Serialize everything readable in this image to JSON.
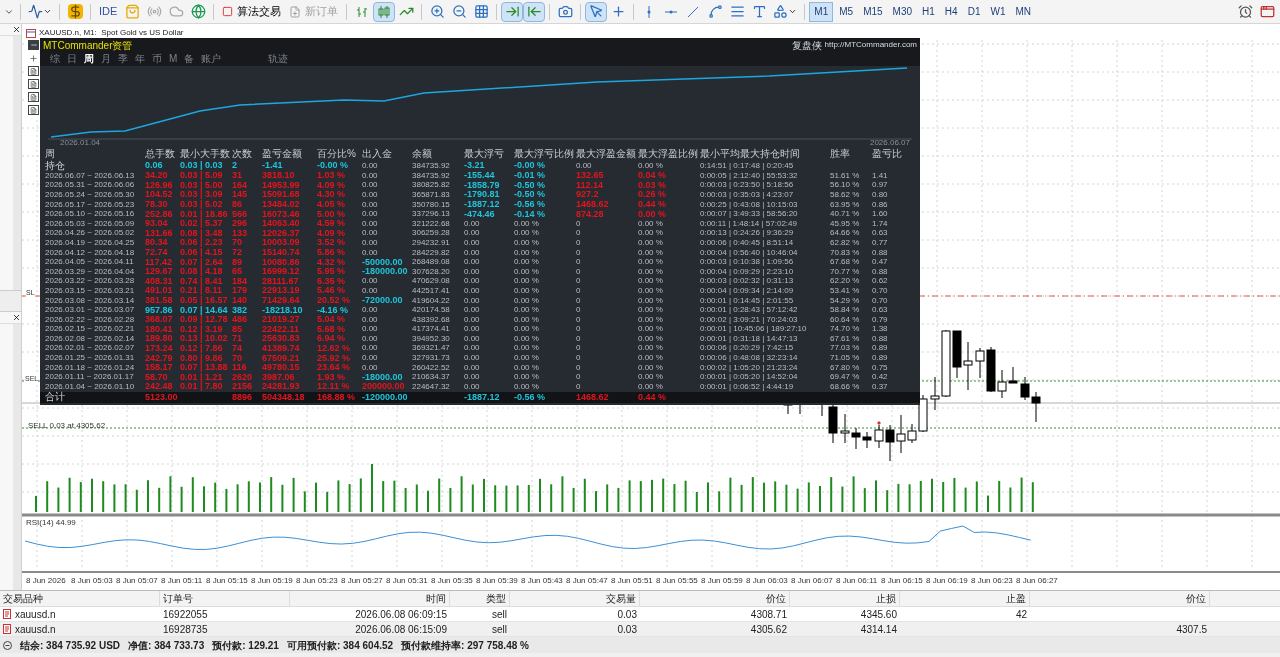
{
  "toolbar": {
    "ide": "IDE",
    "algo_trading": {
      "label": "算法交易",
      "on": false
    },
    "new_order": {
      "label": "新订单",
      "disabled": true
    },
    "chart_types": [
      {
        "selected": false
      },
      {
        "selected": true
      },
      {
        "selected": false
      }
    ],
    "scroll_buttons": [
      {
        "selected": true
      },
      {
        "selected": true
      }
    ],
    "cursor_buttons": [
      {
        "selected": true
      },
      {
        "selected": false
      }
    ],
    "timeframes": [
      {
        "label": "M1",
        "selected": true
      },
      {
        "label": "M5",
        "selected": false
      },
      {
        "label": "M15",
        "selected": false
      },
      {
        "label": "M30",
        "selected": false
      },
      {
        "label": "H1",
        "selected": false
      },
      {
        "label": "H4",
        "selected": false
      },
      {
        "label": "D1",
        "selected": false
      },
      {
        "label": "W1",
        "selected": false
      },
      {
        "label": "MN",
        "selected": false
      }
    ]
  },
  "chart": {
    "title": "XAUUSD.n, M1:  Spot Gold vs US Dollar",
    "sl_label": "SL",
    "sell_label": "SEL",
    "order_label": "SELL 0.03 at 4305.62",
    "rsi_label": "RSI(14) 44.99",
    "time_labels": [
      "8 Jun 2026",
      "8 Jun 05:03",
      "8 Jun 05:07",
      "8 Jun 05:11",
      "8 Jun 05:15",
      "8 Jun 05:19",
      "8 Jun 05:23",
      "8 Jun 05:27",
      "8 Jun 05:31",
      "8 Jun 05:35",
      "8 Jun 05:39",
      "8 Jun 05:43",
      "8 Jun 05:47",
      "8 Jun 05:51",
      "8 Jun 05:55",
      "8 Jun 05:59",
      "8 Jun 06:03",
      "8 Jun 06:07",
      "8 Jun 06:11",
      "8 Jun 06:15",
      "8 Jun 06:19",
      "8 Jun 06:23",
      "8 Jun 06:27"
    ]
  },
  "panel": {
    "title": "MTCommander资管",
    "brand": "复盘侠",
    "link": "http://MTCommander.com",
    "tabs": [
      {
        "label": "综",
        "selected": false
      },
      {
        "label": "日",
        "selected": false
      },
      {
        "label": "周",
        "selected": true
      },
      {
        "label": "月",
        "selected": false
      },
      {
        "label": "季",
        "selected": false
      },
      {
        "label": "年",
        "selected": false
      },
      {
        "label": "币",
        "selected": false
      },
      {
        "label": "M",
        "selected": false
      },
      {
        "label": "备",
        "selected": false
      },
      {
        "label": "账户",
        "selected": false
      },
      {
        "label": "轨迹",
        "selected": false
      }
    ],
    "equity": {
      "start_date": "2026.01.04",
      "end_date": "2026.06.07"
    },
    "table": {
      "columns": [
        "周",
        "总手数",
        "最小大手数",
        "次数",
        "盈亏金额",
        "百分比%",
        "出入金",
        "余额",
        "最大浮亏",
        "最大浮亏比例",
        "最大浮盈金额",
        "最大浮盈比例",
        "最小平均最大持仓时间",
        "胜率",
        "盈亏比"
      ],
      "rows": [
        {
          "kind": "position",
          "cells": [
            {
              "text": "持仓"
            },
            {
              "text": "0.06",
              "color": "#1cc6dc"
            },
            {
              "text": "0.03 | 0.03",
              "color": "#1cc6dc"
            },
            {
              "text": "2",
              "color": "#1cc6dc"
            },
            {
              "text": "-1.41",
              "color": "#1cc6dc"
            },
            {
              "text": "-0.00 %",
              "color": "#1cc6dc"
            },
            {
              "text": "0.00"
            },
            {
              "text": "384735.92"
            },
            {
              "text": "-3.21",
              "color": "#1cc6dc"
            },
            {
              "text": "-0.00 %",
              "color": "#1cc6dc"
            },
            {
              "text": "0.00"
            },
            {
              "text": "0.00 %"
            },
            {
              "text": "0:14:51 | 0:17:48 | 0:20:45"
            },
            null,
            null
          ]
        },
        {
          "kind": "week",
          "cells": [
            {
              "text": "2026.06.07 ~ 2026.06.13"
            },
            {
              "text": "34.20",
              "color": "#e3141e"
            },
            {
              "text": "0.03 | 5.09",
              "color": "#e3141e"
            },
            {
              "text": "31",
              "color": "#e3141e"
            },
            {
              "text": "3818.10",
              "color": "#e3141e"
            },
            {
              "text": "1.03 %",
              "color": "#e3141e"
            },
            {
              "text": "0.00"
            },
            {
              "text": "384735.92"
            },
            {
              "text": "-155.44",
              "color": "#1cc6dc"
            },
            {
              "text": "-0.01 %",
              "color": "#1cc6dc"
            },
            {
              "text": "132.65",
              "color": "#e3141e"
            },
            {
              "text": "0.04 %",
              "color": "#e3141e"
            },
            {
              "text": "0:00:05 | 2:12:40 | 55:53:32"
            },
            {
              "text": "51.61 %"
            },
            {
              "text": "1.41"
            }
          ]
        },
        {
          "kind": "week",
          "cells": [
            {
              "text": "2026.05.31 ~ 2026.06.06"
            },
            {
              "text": "126.96",
              "color": "#e3141e"
            },
            {
              "text": "0.03 | 5.00",
              "color": "#e3141e"
            },
            {
              "text": "164",
              "color": "#e3141e"
            },
            {
              "text": "14953.99",
              "color": "#e3141e"
            },
            {
              "text": "4.09 %",
              "color": "#e3141e"
            },
            {
              "text": "0.00"
            },
            {
              "text": "380825.82"
            },
            {
              "text": "-1858.79",
              "color": "#1cc6dc"
            },
            {
              "text": "-0.50 %",
              "color": "#1cc6dc"
            },
            {
              "text": "112.14",
              "color": "#e3141e"
            },
            {
              "text": "0.03 %",
              "color": "#e3141e"
            },
            {
              "text": "0:00:03 | 0:23:50 | 5:18:56"
            },
            {
              "text": "56.10 %"
            },
            {
              "text": "0.97"
            }
          ]
        },
        {
          "kind": "week",
          "cells": [
            {
              "text": "2026.05.24 ~ 2026.05.30"
            },
            {
              "text": "104.52",
              "color": "#e3141e"
            },
            {
              "text": "0.03 | 3.09",
              "color": "#e3141e"
            },
            {
              "text": "145",
              "color": "#e3141e"
            },
            {
              "text": "15091.68",
              "color": "#e3141e"
            },
            {
              "text": "4.30 %",
              "color": "#e3141e"
            },
            {
              "text": "0.00"
            },
            {
              "text": "365871.83"
            },
            {
              "text": "-1790.81",
              "color": "#1cc6dc"
            },
            {
              "text": "-0.50 %",
              "color": "#1cc6dc"
            },
            {
              "text": "927.2",
              "color": "#e3141e"
            },
            {
              "text": "0.26 %",
              "color": "#e3141e"
            },
            {
              "text": "0:00:03 | 0:35:03 | 4:23:07"
            },
            {
              "text": "58.62 %"
            },
            {
              "text": "0.80"
            }
          ]
        },
        {
          "kind": "week",
          "cells": [
            {
              "text": "2026.05.17 ~ 2026.05.23"
            },
            {
              "text": "78.30",
              "color": "#e3141e"
            },
            {
              "text": "0.03 | 5.02",
              "color": "#e3141e"
            },
            {
              "text": "86",
              "color": "#e3141e"
            },
            {
              "text": "13484.02",
              "color": "#e3141e"
            },
            {
              "text": "4.05 %",
              "color": "#e3141e"
            },
            {
              "text": "0.00"
            },
            {
              "text": "350780.15"
            },
            {
              "text": "-1887.12",
              "color": "#1cc6dc"
            },
            {
              "text": "-0.56 %",
              "color": "#1cc6dc"
            },
            {
              "text": "1468.62",
              "color": "#e3141e"
            },
            {
              "text": "0.44 %",
              "color": "#e3141e"
            },
            {
              "text": "0:00:25 | 0:43:08 | 10:15:03"
            },
            {
              "text": "63.95 %"
            },
            {
              "text": "0.86"
            }
          ]
        },
        {
          "kind": "week",
          "cells": [
            {
              "text": "2026.05.10 ~ 2026.05.16"
            },
            {
              "text": "252.86",
              "color": "#e3141e"
            },
            {
              "text": "0.01 | 18.86",
              "color": "#e3141e"
            },
            {
              "text": "566",
              "color": "#e3141e"
            },
            {
              "text": "16073.46",
              "color": "#e3141e"
            },
            {
              "text": "5.00 %",
              "color": "#e3141e"
            },
            {
              "text": "0.00"
            },
            {
              "text": "337296.13"
            },
            {
              "text": "-474.46",
              "color": "#1cc6dc"
            },
            {
              "text": "-0.14 %",
              "color": "#1cc6dc"
            },
            {
              "text": "874.28",
              "color": "#e3141e"
            },
            {
              "text": "0.00 %",
              "color": "#e3141e"
            },
            {
              "text": "0:00:07 | 3:49:33 | 58:56:20"
            },
            {
              "text": "40.71 %"
            },
            {
              "text": "1.60"
            }
          ]
        },
        {
          "kind": "week",
          "cells": [
            {
              "text": "2026.05.03 ~ 2026.05.09"
            },
            {
              "text": "93.04",
              "color": "#e3141e"
            },
            {
              "text": "0.02 | 5.37",
              "color": "#e3141e"
            },
            {
              "text": "296",
              "color": "#e3141e"
            },
            {
              "text": "14063.40",
              "color": "#e3141e"
            },
            {
              "text": "4.59 %",
              "color": "#e3141e"
            },
            {
              "text": "0.00"
            },
            {
              "text": "321222.68"
            },
            {
              "text": "0.00"
            },
            {
              "text": "0.00 %"
            },
            {
              "text": "0"
            },
            {
              "text": "0.00 %"
            },
            {
              "text": "0:00:11 | 1:48:14 | 57:02:49"
            },
            {
              "text": "45.95 %"
            },
            {
              "text": "1.74"
            }
          ]
        },
        {
          "kind": "week",
          "cells": [
            {
              "text": "2026.04.26 ~ 2026.05.02"
            },
            {
              "text": "131.66",
              "color": "#e3141e"
            },
            {
              "text": "0.08 | 3.48",
              "color": "#e3141e"
            },
            {
              "text": "133",
              "color": "#e3141e"
            },
            {
              "text": "12026.37",
              "color": "#e3141e"
            },
            {
              "text": "4.09 %",
              "color": "#e3141e"
            },
            {
              "text": "0.00"
            },
            {
              "text": "306259.28"
            },
            {
              "text": "0.00"
            },
            {
              "text": "0.00 %"
            },
            {
              "text": "0"
            },
            {
              "text": "0.00 %"
            },
            {
              "text": "0:00:13 | 0:24:26 | 9:36:29"
            },
            {
              "text": "64.66 %"
            },
            {
              "text": "0.63"
            }
          ]
        },
        {
          "kind": "week",
          "cells": [
            {
              "text": "2026.04.19 ~ 2026.04.25"
            },
            {
              "text": "80.34",
              "color": "#e3141e"
            },
            {
              "text": "0.06 | 2.23",
              "color": "#e3141e"
            },
            {
              "text": "70",
              "color": "#e3141e"
            },
            {
              "text": "10003.09",
              "color": "#e3141e"
            },
            {
              "text": "3.52 %",
              "color": "#e3141e"
            },
            {
              "text": "0.00"
            },
            {
              "text": "294232.91"
            },
            {
              "text": "0.00"
            },
            {
              "text": "0.00 %"
            },
            {
              "text": "0"
            },
            {
              "text": "0.00 %"
            },
            {
              "text": "0:00:06 | 0:40:45 | 8:51:14"
            },
            {
              "text": "62.82 %"
            },
            {
              "text": "0.77"
            }
          ]
        },
        {
          "kind": "week",
          "cells": [
            {
              "text": "2026.04.12 ~ 2026.04.18"
            },
            {
              "text": "72.74",
              "color": "#e3141e"
            },
            {
              "text": "0.06 | 4.15",
              "color": "#e3141e"
            },
            {
              "text": "72",
              "color": "#e3141e"
            },
            {
              "text": "15140.74",
              "color": "#e3141e"
            },
            {
              "text": "5.86 %",
              "color": "#e3141e"
            },
            {
              "text": "0.00"
            },
            {
              "text": "284229.82"
            },
            {
              "text": "0.00"
            },
            {
              "text": "0.00 %"
            },
            {
              "text": "0"
            },
            {
              "text": "0.00 %"
            },
            {
              "text": "0:00:04 | 0:56:40 | 10:46:04"
            },
            {
              "text": "70.83 %"
            },
            {
              "text": "0.88"
            }
          ]
        },
        {
          "kind": "week",
          "cells": [
            {
              "text": "2026.04.05 ~ 2026.04.11"
            },
            {
              "text": "117.42",
              "color": "#e3141e"
            },
            {
              "text": "0.07 | 2.64",
              "color": "#e3141e"
            },
            {
              "text": "89",
              "color": "#e3141e"
            },
            {
              "text": "10080.86",
              "color": "#e3141e"
            },
            {
              "text": "4.32 %",
              "color": "#e3141e"
            },
            {
              "text": "-50000.00",
              "color": "#1cc6dc"
            },
            {
              "text": "268489.08"
            },
            {
              "text": "0.00"
            },
            {
              "text": "0.00 %"
            },
            {
              "text": "0"
            },
            {
              "text": "0.00 %"
            },
            {
              "text": "0:00:03 | 0:10:38 | 1:09:56"
            },
            {
              "text": "67.68 %"
            },
            {
              "text": "0.47"
            }
          ]
        },
        {
          "kind": "week",
          "cells": [
            {
              "text": "2026.03.29 ~ 2026.04.04"
            },
            {
              "text": "129.67",
              "color": "#e3141e"
            },
            {
              "text": "0.08 | 4.18",
              "color": "#e3141e"
            },
            {
              "text": "65",
              "color": "#e3141e"
            },
            {
              "text": "16999.12",
              "color": "#e3141e"
            },
            {
              "text": "5.95 %",
              "color": "#e3141e"
            },
            {
              "text": "-180000.00",
              "color": "#1cc6dc"
            },
            {
              "text": "307628.20"
            },
            {
              "text": "0.00"
            },
            {
              "text": "0.00 %"
            },
            {
              "text": "0"
            },
            {
              "text": "0.00 %"
            },
            {
              "text": "0:00:04 | 0:09:29 | 2:23:10"
            },
            {
              "text": "70.77 %"
            },
            {
              "text": "0.88"
            }
          ]
        },
        {
          "kind": "week",
          "cells": [
            {
              "text": "2026.03.22 ~ 2026.03.28"
            },
            {
              "text": "408.31",
              "color": "#e3141e"
            },
            {
              "text": "0.74 | 8.41",
              "color": "#e3141e"
            },
            {
              "text": "184",
              "color": "#e3141e"
            },
            {
              "text": "28111.67",
              "color": "#e3141e"
            },
            {
              "text": "6.35 %",
              "color": "#e3141e"
            },
            {
              "text": "0.00"
            },
            {
              "text": "470629.08"
            },
            {
              "text": "0.00"
            },
            {
              "text": "0.00 %"
            },
            {
              "text": "0"
            },
            {
              "text": "0.00 %"
            },
            {
              "text": "0:00:03 | 0:02:32 | 0:31:13"
            },
            {
              "text": "62.20 %"
            },
            {
              "text": "0.62"
            }
          ]
        },
        {
          "kind": "week",
          "cells": [
            {
              "text": "2026.03.15 ~ 2026.03.21"
            },
            {
              "text": "491.01",
              "color": "#e3141e"
            },
            {
              "text": "0.21 | 8.11",
              "color": "#e3141e"
            },
            {
              "text": "179",
              "color": "#e3141e"
            },
            {
              "text": "22913.19",
              "color": "#e3141e"
            },
            {
              "text": "5.46 %",
              "color": "#e3141e"
            },
            {
              "text": "0.00"
            },
            {
              "text": "442517.41"
            },
            {
              "text": "0.00"
            },
            {
              "text": "0.00 %"
            },
            {
              "text": "0"
            },
            {
              "text": "0.00 %"
            },
            {
              "text": "0:00:04 | 0:09:34 | 2:14:09"
            },
            {
              "text": "53.41 %"
            },
            {
              "text": "0.70"
            }
          ]
        },
        {
          "kind": "week",
          "cells": [
            {
              "text": "2026.03.08 ~ 2026.03.14"
            },
            {
              "text": "381.58",
              "color": "#e3141e"
            },
            {
              "text": "0.05 | 16.57",
              "color": "#e3141e"
            },
            {
              "text": "140",
              "color": "#e3141e"
            },
            {
              "text": "71429.64",
              "color": "#e3141e"
            },
            {
              "text": "20.52 %",
              "color": "#e3141e"
            },
            {
              "text": "-72000.00",
              "color": "#1cc6dc"
            },
            {
              "text": "419604.22"
            },
            {
              "text": "0.00"
            },
            {
              "text": "0.00 %"
            },
            {
              "text": "0"
            },
            {
              "text": "0.00 %"
            },
            {
              "text": "0:00:01 | 0:14:45 | 2:01:55"
            },
            {
              "text": "54.29 %"
            },
            {
              "text": "0.70"
            }
          ]
        },
        {
          "kind": "week",
          "cells": [
            {
              "text": "2026.03.01 ~ 2026.03.07"
            },
            {
              "text": "957.86",
              "color": "#1cc6dc"
            },
            {
              "text": "0.07 | 14.64",
              "color": "#1cc6dc"
            },
            {
              "text": "382",
              "color": "#1cc6dc"
            },
            {
              "text": "-18218.10",
              "color": "#1cc6dc"
            },
            {
              "text": "-4.16 %",
              "color": "#1cc6dc"
            },
            {
              "text": "0.00"
            },
            {
              "text": "420174.58"
            },
            {
              "text": "0.00"
            },
            {
              "text": "0.00 %"
            },
            {
              "text": "0"
            },
            {
              "text": "0.00 %"
            },
            {
              "text": "0:00:01 | 0:28:43 | 57:12:42"
            },
            {
              "text": "58.84 %"
            },
            {
              "text": "0.63"
            }
          ]
        },
        {
          "kind": "week",
          "cells": [
            {
              "text": "2026.02.22 ~ 2026.02.28"
            },
            {
              "text": "368.07",
              "color": "#e3141e"
            },
            {
              "text": "0.09 | 12.78",
              "color": "#e3141e"
            },
            {
              "text": "486",
              "color": "#e3141e"
            },
            {
              "text": "21019.27",
              "color": "#e3141e"
            },
            {
              "text": "5.04 %",
              "color": "#e3141e"
            },
            {
              "text": "0.00"
            },
            {
              "text": "438392.68"
            },
            {
              "text": "0.00"
            },
            {
              "text": "0.00 %"
            },
            {
              "text": "0"
            },
            {
              "text": "0.00 %"
            },
            {
              "text": "0:00:02 | 3:09:21 | 70:24:03"
            },
            {
              "text": "60.64 %"
            },
            {
              "text": "0.79"
            }
          ]
        },
        {
          "kind": "week",
          "cells": [
            {
              "text": "2026.02.15 ~ 2026.02.21"
            },
            {
              "text": "180.41",
              "color": "#e3141e"
            },
            {
              "text": "0.12 | 3.19",
              "color": "#e3141e"
            },
            {
              "text": "85",
              "color": "#e3141e"
            },
            {
              "text": "22422.11",
              "color": "#e3141e"
            },
            {
              "text": "5.68 %",
              "color": "#e3141e"
            },
            {
              "text": "0.00"
            },
            {
              "text": "417374.41"
            },
            {
              "text": "0.00"
            },
            {
              "text": "0.00 %"
            },
            {
              "text": "0"
            },
            {
              "text": "0.00 %"
            },
            {
              "text": "0:00:01 | 10:45:06 | 189:27:10"
            },
            {
              "text": "74.70 %"
            },
            {
              "text": "1.38"
            }
          ]
        },
        {
          "kind": "week",
          "cells": [
            {
              "text": "2026.02.08 ~ 2026.02.14"
            },
            {
              "text": "189.80",
              "color": "#e3141e"
            },
            {
              "text": "0.13 | 10.02",
              "color": "#e3141e"
            },
            {
              "text": "71",
              "color": "#e3141e"
            },
            {
              "text": "25630.83",
              "color": "#e3141e"
            },
            {
              "text": "6.94 %",
              "color": "#e3141e"
            },
            {
              "text": "0.00"
            },
            {
              "text": "394952.30"
            },
            {
              "text": "0.00"
            },
            {
              "text": "0.00 %"
            },
            {
              "text": "0"
            },
            {
              "text": "0.00 %"
            },
            {
              "text": "0:00:01 | 0:31:18 | 14:47:13"
            },
            {
              "text": "67.61 %"
            },
            {
              "text": "0.88"
            }
          ]
        },
        {
          "kind": "week",
          "cells": [
            {
              "text": "2026.02.01 ~ 2026.02.07"
            },
            {
              "text": "173.24",
              "color": "#e3141e"
            },
            {
              "text": "0.12 | 7.86",
              "color": "#e3141e"
            },
            {
              "text": "74",
              "color": "#e3141e"
            },
            {
              "text": "41389.74",
              "color": "#e3141e"
            },
            {
              "text": "12.62 %",
              "color": "#e3141e"
            },
            {
              "text": "0.00"
            },
            {
              "text": "369321.47"
            },
            {
              "text": "0.00"
            },
            {
              "text": "0.00 %"
            },
            {
              "text": "0"
            },
            {
              "text": "0.00 %"
            },
            {
              "text": "0:00:06 | 0:20:29 | 7:42:15"
            },
            {
              "text": "77.03 %"
            },
            {
              "text": "0.89"
            }
          ]
        },
        {
          "kind": "week",
          "cells": [
            {
              "text": "2026.01.25 ~ 2026.01.31"
            },
            {
              "text": "242.79",
              "color": "#e3141e"
            },
            {
              "text": "0.80 | 9.86",
              "color": "#e3141e"
            },
            {
              "text": "70",
              "color": "#e3141e"
            },
            {
              "text": "67509.21",
              "color": "#e3141e"
            },
            {
              "text": "25.92 %",
              "color": "#e3141e"
            },
            {
              "text": "0.00"
            },
            {
              "text": "327931.73"
            },
            {
              "text": "0.00"
            },
            {
              "text": "0.00 %"
            },
            {
              "text": "0"
            },
            {
              "text": "0.00 %"
            },
            {
              "text": "0:00:06 | 0:48:08 | 32:23:14"
            },
            {
              "text": "71.05 %"
            },
            {
              "text": "0.89"
            }
          ]
        },
        {
          "kind": "week",
          "cells": [
            {
              "text": "2026.01.18 ~ 2026.01.24"
            },
            {
              "text": "158.17",
              "color": "#e3141e"
            },
            {
              "text": "0.07 | 13.88",
              "color": "#e3141e"
            },
            {
              "text": "116",
              "color": "#e3141e"
            },
            {
              "text": "49780.15",
              "color": "#e3141e"
            },
            {
              "text": "23.64 %",
              "color": "#e3141e"
            },
            {
              "text": "0.00"
            },
            {
              "text": "260422.52"
            },
            {
              "text": "0.00"
            },
            {
              "text": "0.00 %"
            },
            {
              "text": "0"
            },
            {
              "text": "0.00 %"
            },
            {
              "text": "0:00:02 | 1:05:20 | 21:23:24"
            },
            {
              "text": "67.80 %"
            },
            {
              "text": "0.75"
            }
          ]
        },
        {
          "kind": "week",
          "cells": [
            {
              "text": "2026.01.11 ~ 2026.01.17"
            },
            {
              "text": "58.70",
              "color": "#e3141e"
            },
            {
              "text": "0.01 | 1.21",
              "color": "#e3141e"
            },
            {
              "text": "2620",
              "color": "#e3141e"
            },
            {
              "text": "3987.06",
              "color": "#e3141e"
            },
            {
              "text": "1.93 %",
              "color": "#e3141e"
            },
            {
              "text": "-18000.00",
              "color": "#1cc6dc"
            },
            {
              "text": "210634.37"
            },
            {
              "text": "0.00"
            },
            {
              "text": "0.00 %"
            },
            {
              "text": "0"
            },
            {
              "text": "0.00 %"
            },
            {
              "text": "0:00:01 | 0:05:20 | 14:52:04"
            },
            {
              "text": "69.47 %"
            },
            {
              "text": "0.42"
            }
          ]
        },
        {
          "kind": "week",
          "cells": [
            {
              "text": "2026.01.04 ~ 2026.01.10"
            },
            {
              "text": "242.48",
              "color": "#e3141e"
            },
            {
              "text": "0.01 | 7.80",
              "color": "#e3141e"
            },
            {
              "text": "2156",
              "color": "#e3141e"
            },
            {
              "text": "24281.93",
              "color": "#e3141e"
            },
            {
              "text": "12.11 %",
              "color": "#e3141e"
            },
            {
              "text": "200000.00",
              "color": "#e3141e"
            },
            {
              "text": "224647.32"
            },
            {
              "text": "0.00"
            },
            {
              "text": "0.00 %"
            },
            {
              "text": "0"
            },
            {
              "text": "0.00 %"
            },
            {
              "text": "0:00:01 | 0:06:52 | 4:44:19"
            },
            {
              "text": "68.66 %"
            },
            {
              "text": "0.37"
            }
          ]
        },
        {
          "kind": "total",
          "cells": [
            {
              "text": "合计"
            },
            {
              "text": "5123.00",
              "color": "#e3141e"
            },
            null,
            {
              "text": "8896",
              "color": "#e3141e"
            },
            {
              "text": "504348.18",
              "color": "#e3141e"
            },
            {
              "text": "168.88 %",
              "color": "#e3141e"
            },
            {
              "text": "-120000.00",
              "color": "#1cc6dc"
            },
            null,
            {
              "text": "-1887.12",
              "color": "#1cc6dc"
            },
            {
              "text": "-0.56 %",
              "color": "#1cc6dc"
            },
            {
              "text": "1468.62",
              "color": "#e3141e"
            },
            {
              "text": "0.44 %",
              "color": "#e3141e"
            },
            null,
            null,
            null
          ]
        }
      ]
    }
  },
  "positions": {
    "columns": [
      "交易品种",
      "订单号",
      "时间",
      "类型",
      "交易量",
      "价位",
      "止损",
      "止盈",
      "价位"
    ],
    "rows": [
      {
        "cells": [
          "xauusd.n",
          "16922055",
          "2026.06.08 06:09:15",
          "sell",
          "0.03",
          "4308.71",
          "4345.60",
          "42",
          null
        ]
      },
      {
        "cells": [
          "xauusd.n",
          "16928735",
          "2026.06.08 06:15:09",
          "sell",
          "0.03",
          "4305.62",
          "4314.14",
          null,
          "4307.5"
        ]
      }
    ]
  },
  "status_bar": [
    "结余: 384 735.92 USD",
    "净值: 384 733.73",
    "预付款: 129.21",
    "可用预付款: 384 604.52",
    "预付款维持率: 297 758.48 %"
  ]
}
